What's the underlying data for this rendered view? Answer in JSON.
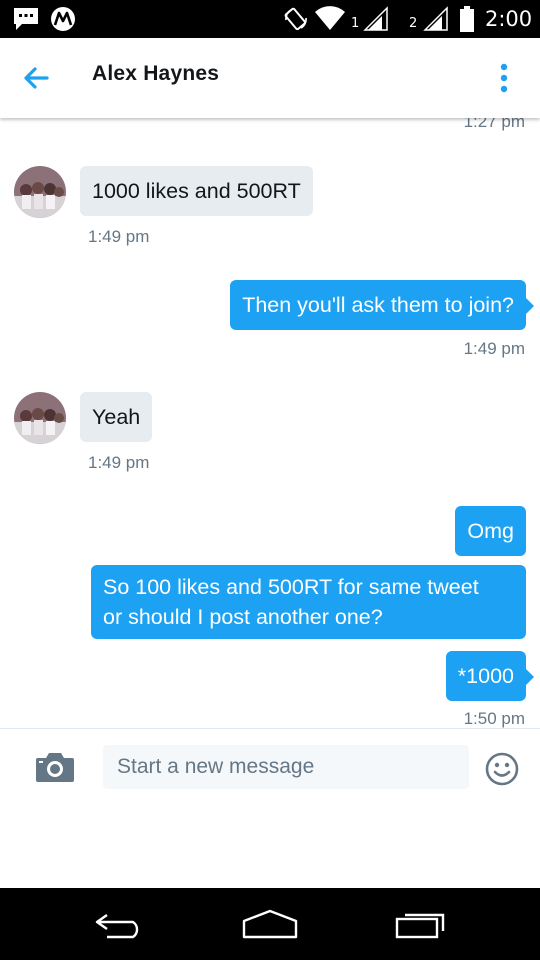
{
  "status_bar": {
    "time": "2:00",
    "sim1_label": "1",
    "sim2_label": "2",
    "icons": [
      "chat-icon",
      "motorola-icon",
      "rotation-icon",
      "wifi-icon",
      "signal-icon",
      "signal-icon",
      "battery-icon"
    ]
  },
  "header": {
    "title": "Alex Haynes",
    "back_icon": "back-arrow-icon",
    "menu_icon": "more-vert-icon"
  },
  "conversation": {
    "clipped_timestamp": "1:27 pm",
    "messages": [
      {
        "direction": "in",
        "text": "1000 likes and 500RT",
        "time": "1:49 pm"
      },
      {
        "direction": "out",
        "text": "Then you'll ask them to join?",
        "time": "1:49 pm"
      },
      {
        "direction": "in",
        "text": "Yeah",
        "time": "1:49 pm"
      },
      {
        "direction": "out",
        "text": "Omg"
      },
      {
        "direction": "out",
        "line1": "So 100 likes and 500RT for same tweet",
        "line2": "or should I post another one?"
      },
      {
        "direction": "out",
        "text": "*1000",
        "time": "1:50 pm"
      }
    ]
  },
  "composer": {
    "placeholder": "Start a new message",
    "camera_icon": "camera-icon",
    "emoji_icon": "emoji-icon"
  },
  "colors": {
    "accent": "#1da1f2",
    "incoming_bubble": "#e6ecf0",
    "text_primary": "#14171a",
    "text_secondary": "#657786",
    "icon_gray": "#657786"
  },
  "nav_bar": {
    "icons": [
      "back-nav-icon",
      "home-nav-icon",
      "recents-nav-icon"
    ]
  }
}
